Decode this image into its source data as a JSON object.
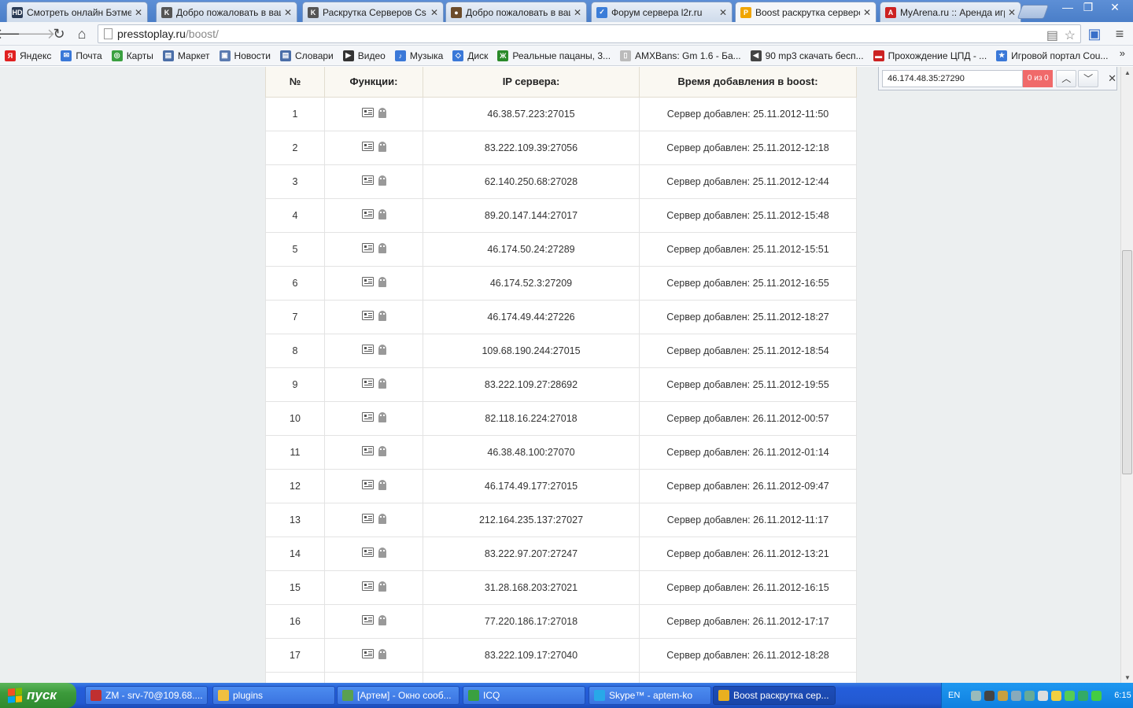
{
  "browser": {
    "tabs": [
      {
        "title": "Смотреть онлайн Бэтмен",
        "icon": "hd-favicon",
        "color": "#2a3b55",
        "glyph": "HD",
        "active": false
      },
      {
        "title": "Добро пожаловать в ваш",
        "icon": "cs-favicon",
        "color": "#555555",
        "glyph": "K",
        "active": false
      },
      {
        "title": "Раскрутка Серверов Cs",
        "icon": "cs-favicon",
        "color": "#555555",
        "glyph": "K",
        "active": false
      },
      {
        "title": "Добро пожаловать в ваш",
        "icon": "character-favicon",
        "color": "#6b4b2a",
        "glyph": "●",
        "active": false
      },
      {
        "title": "Форум сервера l2r.ru",
        "icon": "forum-favicon",
        "color": "#3b7dd8",
        "glyph": "✓",
        "active": false
      },
      {
        "title": "Boost раскрутка серверо",
        "icon": "boost-favicon",
        "color": "#f0a500",
        "glyph": "P",
        "active": true
      },
      {
        "title": "MyArena.ru :: Аренда игр",
        "icon": "myarena-favicon",
        "color": "#cc2222",
        "glyph": "A",
        "active": false
      }
    ],
    "url_host": "presstoplay.ru",
    "url_path": "/boost/",
    "bookmarks": [
      {
        "label": "Яндекс",
        "color": "#e02020",
        "glyph": "Я"
      },
      {
        "label": "Почта",
        "color": "#3a78d8",
        "glyph": "✉"
      },
      {
        "label": "Карты",
        "color": "#3aa040",
        "glyph": "◎"
      },
      {
        "label": "Маркет",
        "color": "#4a6ea8",
        "glyph": "▤"
      },
      {
        "label": "Новости",
        "color": "#5b7bb0",
        "glyph": "▣"
      },
      {
        "label": "Словари",
        "color": "#4a6ea8",
        "glyph": "▤"
      },
      {
        "label": "Видео",
        "color": "#333333",
        "glyph": "▶"
      },
      {
        "label": "Музыка",
        "color": "#3a78d8",
        "glyph": "♪"
      },
      {
        "label": "Диск",
        "color": "#3a78d8",
        "glyph": "◇"
      },
      {
        "label": "Реальные пацаны, 3...",
        "color": "#2a8a2a",
        "glyph": "Ж"
      },
      {
        "label": "AMXBans: Gm 1.6 - Ба...",
        "color": "#bbbbbb",
        "glyph": "▯"
      },
      {
        "label": "90 mp3 скачать бесп...",
        "color": "#444444",
        "glyph": "◀"
      },
      {
        "label": "Прохождение ЦПД - ...",
        "color": "#cc2222",
        "glyph": "▬"
      },
      {
        "label": "Игровой портал Cou...",
        "color": "#3a78d8",
        "glyph": "★"
      }
    ]
  },
  "table": {
    "headers": [
      "№",
      "Функции:",
      "IP сервера:",
      "Время добавления в boost:"
    ],
    "rows": [
      {
        "num": "1",
        "ip": "46.38.57.223:27015",
        "added": "Сервер добавлен: 25.11.2012-11:50"
      },
      {
        "num": "2",
        "ip": "83.222.109.39:27056",
        "added": "Сервер добавлен: 25.11.2012-12:18"
      },
      {
        "num": "3",
        "ip": "62.140.250.68:27028",
        "added": "Сервер добавлен: 25.11.2012-12:44"
      },
      {
        "num": "4",
        "ip": "89.20.147.144:27017",
        "added": "Сервер добавлен: 25.11.2012-15:48"
      },
      {
        "num": "5",
        "ip": "46.174.50.24:27289",
        "added": "Сервер добавлен: 25.11.2012-15:51"
      },
      {
        "num": "6",
        "ip": "46.174.52.3:27209",
        "added": "Сервер добавлен: 25.11.2012-16:55"
      },
      {
        "num": "7",
        "ip": "46.174.49.44:27226",
        "added": "Сервер добавлен: 25.11.2012-18:27"
      },
      {
        "num": "8",
        "ip": "109.68.190.244:27015",
        "added": "Сервер добавлен: 25.11.2012-18:54"
      },
      {
        "num": "9",
        "ip": "83.222.109.27:28692",
        "added": "Сервер добавлен: 25.11.2012-19:55"
      },
      {
        "num": "10",
        "ip": "82.118.16.224:27018",
        "added": "Сервер добавлен: 26.11.2012-00:57"
      },
      {
        "num": "11",
        "ip": "46.38.48.100:27070",
        "added": "Сервер добавлен: 26.11.2012-01:14"
      },
      {
        "num": "12",
        "ip": "46.174.49.177:27015",
        "added": "Сервер добавлен: 26.11.2012-09:47"
      },
      {
        "num": "13",
        "ip": "212.164.235.137:27027",
        "added": "Сервер добавлен: 26.11.2012-11:17"
      },
      {
        "num": "14",
        "ip": "83.222.97.207:27247",
        "added": "Сервер добавлен: 26.11.2012-13:21"
      },
      {
        "num": "15",
        "ip": "31.28.168.203:27021",
        "added": "Сервер добавлен: 26.11.2012-16:15"
      },
      {
        "num": "16",
        "ip": "77.220.186.17:27018",
        "added": "Сервер добавлен: 26.11.2012-17:17"
      },
      {
        "num": "17",
        "ip": "83.222.109.17:27040",
        "added": "Сервер добавлен: 26.11.2012-18:28"
      },
      {
        "num": "",
        "ip": "",
        "added": ""
      }
    ],
    "function_icons": [
      "server-info-icon",
      "ghost-icon"
    ]
  },
  "findbar": {
    "query": "46.174.48.35:27290",
    "count": "0 из 0",
    "count_color": "#f06a6a"
  },
  "taskbar": {
    "start_label": "пуск",
    "tasks": [
      {
        "label": "ZM - srv-70@109.68....",
        "icon": "filezilla-icon",
        "color": "#c03030",
        "active": false
      },
      {
        "label": "plugins",
        "icon": "folder-icon",
        "color": "#f0c040",
        "active": false
      },
      {
        "label": "[Артем] - Окно сооб...",
        "icon": "message-window-icon",
        "color": "#5aa050",
        "active": false
      },
      {
        "label": "ICQ",
        "icon": "icq-icon",
        "color": "#3aa040",
        "active": false
      },
      {
        "label": "Skype™ - aptem-ko",
        "icon": "skype-icon",
        "color": "#28a8e8",
        "active": false
      },
      {
        "label": "Boost раскрутка сер...",
        "icon": "chrome-icon",
        "color": "#e8b020",
        "active": true
      }
    ],
    "lang": "EN",
    "clock": "6:15"
  }
}
